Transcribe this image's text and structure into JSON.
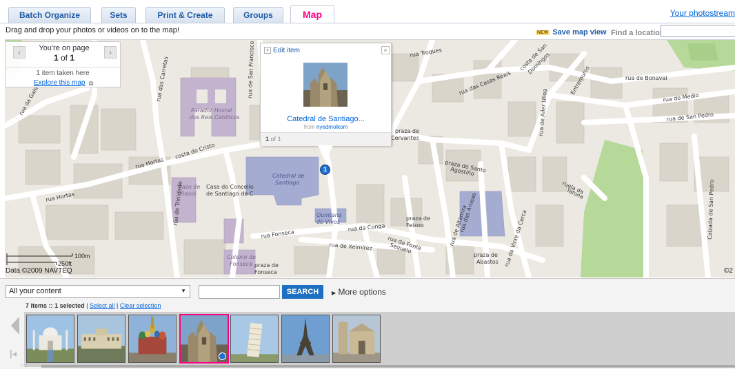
{
  "tabs": [
    {
      "label": "Batch Organize",
      "active": false
    },
    {
      "label": "Sets",
      "active": false
    },
    {
      "label": "Print & Create",
      "active": false
    },
    {
      "label": "Groups",
      "active": false
    },
    {
      "label": "Map",
      "active": true
    }
  ],
  "header": {
    "photostream_link": "Your photostream"
  },
  "toolbar": {
    "instruction": "Drag and drop your photos or videos on to the map!",
    "new_badge": "NEW",
    "save_map_view": "Save map view",
    "find_location_label": "Find a location",
    "find_location_value": ""
  },
  "map": {
    "nav": {
      "on_page_text": "You're on page",
      "page_current": "1",
      "page_of": "of",
      "page_total": "1",
      "items_taken": "1 item taken here",
      "explore_link": "Explore this map"
    },
    "popup": {
      "edit_label": "Edit item",
      "close_glyph": "×",
      "title": "Catedral de Santiago...",
      "from_prefix": "from",
      "owner": "nyedmolkom",
      "count_current": "1",
      "count_text": "of 1"
    },
    "marker_label": "1",
    "scale_metric": "100m",
    "scale_imperial": "250ft",
    "copyright": "Data ©2009 NAVTEQ",
    "copyright_right": "©2",
    "street_labels": [
      "rua da Galeras",
      "rua das Carretas",
      "rua de San Francisco",
      "Parador Hostal dos Reis Católicos",
      "costa do Cristo",
      "rua Hortas",
      "rua Hortas",
      "rúa da Trinidade",
      "Pazo de Raxoi",
      "Casa do Concello de Santiago de C",
      "Catedral de Santiago",
      "Quintana de Vivos",
      "rua Fonseca",
      "Colexio de Fonseca",
      "praza de Fonseca",
      "rua da Conga",
      "rua de Xelmírez",
      "rua da Fonte Sequelo",
      "praza de Feixoo",
      "praza de Cervantes",
      "praza de Santo Agostiño",
      "rua Troques",
      "rua das Casas Reais",
      "rua de Bonaval",
      "rua do Medio",
      "rua de San Pedro",
      "rua da Virxe da Cerca",
      "ruela de Tafona",
      "Calzada de San Pedro",
      "praza de Abastos",
      "rua das Ameas",
      "rua de Altamira",
      "rua de Ailer Ulloa",
      "costa de San Domingos",
      "rúa de Entremuros"
    ]
  },
  "bottom_panel": {
    "content_filter": "All your content",
    "search_value": "",
    "search_button": "SEARCH",
    "more_options": "More options",
    "items_count": "7 items",
    "selected_count": "1 selected",
    "separator": "::",
    "select_all": "Select all",
    "clear_selection": "Clear selection",
    "thumbnails": [
      {
        "name": "taj-mahal",
        "selected": false
      },
      {
        "name": "palace",
        "selected": false
      },
      {
        "name": "st-basils",
        "selected": false
      },
      {
        "name": "catedral-santiago",
        "selected": true
      },
      {
        "name": "pisa-tower",
        "selected": false
      },
      {
        "name": "eiffel-tower",
        "selected": false
      },
      {
        "name": "murcia-cathedral",
        "selected": false
      }
    ]
  },
  "colors": {
    "link": "#0063dc",
    "active_tab": "#ff0084",
    "tab_text": "#1f5aa6",
    "search_button": "#1d6fc2",
    "map_bg": "#ece9e2"
  }
}
